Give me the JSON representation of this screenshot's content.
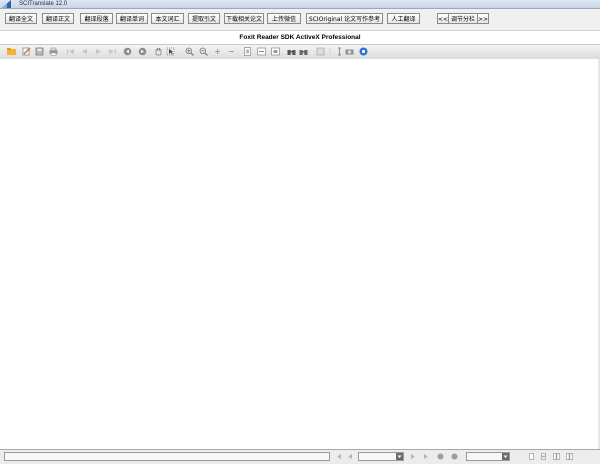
{
  "window": {
    "title": "SCITranslate 12.0"
  },
  "top_buttons": [
    {
      "label": "翻译全文",
      "name": "translate-full-button"
    },
    {
      "label": "翻译正文",
      "name": "translate-body-button"
    },
    {
      "label": "翻译段落",
      "name": "translate-paragraph-button"
    },
    {
      "label": "翻译单词",
      "name": "translate-word-button"
    },
    {
      "label": "本文词汇",
      "name": "article-vocabulary-button"
    },
    {
      "label": "提取引文",
      "name": "extract-citations-button"
    },
    {
      "label": "下载相关论文",
      "name": "download-related-papers-button"
    },
    {
      "label": "上传微信",
      "name": "upload-wechat-button"
    },
    {
      "label": "SCIOriginal 论文写作参考",
      "name": "sci-original-writing-button"
    },
    {
      "label": "人工翻译",
      "name": "human-translation-button"
    }
  ],
  "split_control": {
    "prev": "<<",
    "label": "调节分栏",
    "next": ">>"
  },
  "viewer_caption": "Foxit Reader SDK ActiveX Professional",
  "toolbar_icons": [
    "open-folder-icon",
    "edit-icon",
    "save-icon",
    "print-icon",
    "first-page-icon",
    "prev-page-icon",
    "next-page-icon",
    "last-page-icon",
    "back-icon",
    "forward-icon",
    "hand-tool-icon",
    "select-tool-icon",
    "zoom-in-icon",
    "zoom-out-icon",
    "zoom-in-small-icon",
    "zoom-out-small-icon",
    "fit-page-icon",
    "fit-width-icon",
    "actual-size-icon",
    "search-binoculars-icon",
    "find-icon",
    "snapshot-icon",
    "pan-icon",
    "text-cursor-icon",
    "camera-icon",
    "help-icon"
  ]
}
